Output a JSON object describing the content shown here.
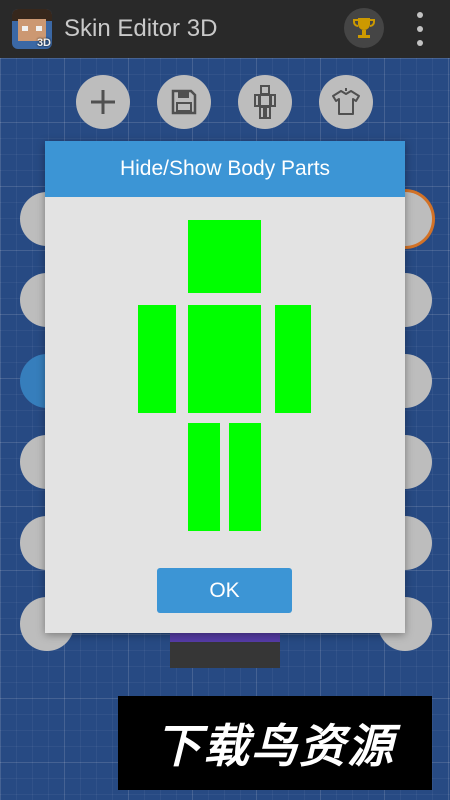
{
  "app": {
    "title": "Skin Editor 3D",
    "icon_badge": "3D",
    "icons": {
      "app": "app-icon-steve-head",
      "trophy": "trophy-icon",
      "menu": "overflow-menu-icon"
    }
  },
  "toolbar": {
    "buttons": [
      {
        "name": "add",
        "icon": "plus-icon"
      },
      {
        "name": "save",
        "icon": "floppy-disk-icon"
      },
      {
        "name": "body-parts",
        "icon": "body-figure-icon"
      },
      {
        "name": "clothing",
        "icon": "shirt-icon"
      }
    ]
  },
  "dialog": {
    "title": "Hide/Show Body Parts",
    "parts": [
      "head",
      "body",
      "left-arm",
      "right-arm",
      "left-leg",
      "right-leg"
    ],
    "part_color": "#00ff00",
    "ok_label": "OK"
  },
  "watermark": {
    "text": "下载鸟资源"
  },
  "colors": {
    "accent": "#3c95d5",
    "topbar": "#2c2c2c",
    "background": "#2a4f8c"
  }
}
